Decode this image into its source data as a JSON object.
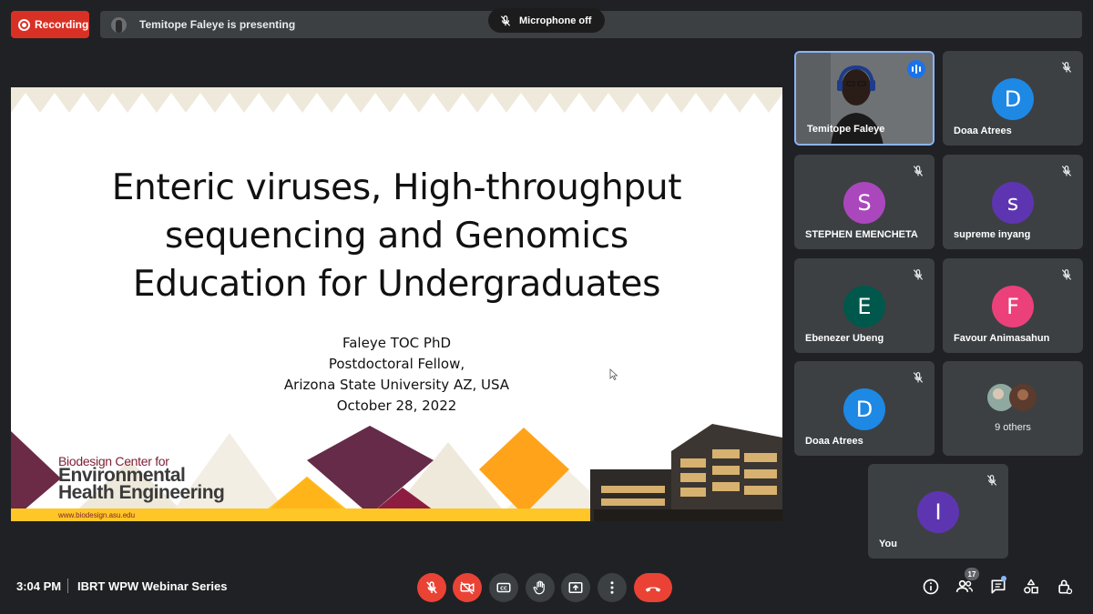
{
  "top": {
    "recording_label": "Recording",
    "presenting_text": "Temitope Faleye is presenting",
    "mic_toast": "Microphone off"
  },
  "slide": {
    "title_lines": [
      "Enteric viruses, High-throughput",
      "sequencing and Genomics",
      "Education for Undergraduates"
    ],
    "author": "Faleye TOC PhD",
    "role": "Postdoctoral Fellow,",
    "institution": "Arizona State University AZ, USA",
    "date": "October 28, 2022",
    "org_line1": "Biodesign Center for",
    "org_line2": "Environmental",
    "org_line3": "Health Engineering",
    "org_url": "www.biodesign.asu.edu"
  },
  "participants": [
    {
      "name": "Temitope Faleye",
      "initial": "",
      "color": "",
      "speaking": true
    },
    {
      "name": "Doaa Atrees",
      "initial": "D",
      "color": "#1e88e5"
    },
    {
      "name": "STEPHEN EMENCHETA",
      "initial": "S",
      "color": "#ab47bc"
    },
    {
      "name": "supreme inyang",
      "initial": "s",
      "color": "#5e35b1"
    },
    {
      "name": "Ebenezer Ubeng",
      "initial": "E",
      "color": "#00574b"
    },
    {
      "name": "Favour Animasahun",
      "initial": "F",
      "color": "#ec407a"
    },
    {
      "name": "Doaa Atrees",
      "initial": "D",
      "color": "#1e88e5"
    },
    {
      "name": "You",
      "initial": "I",
      "color": "#5e35b1"
    }
  ],
  "others_label": "9 others",
  "bottom": {
    "time": "3:04 PM",
    "meeting_title": "IBRT WPW Webinar Series",
    "participant_count": "17"
  },
  "icons": [
    "recording-icon",
    "mic-off-icon",
    "camera-off-icon",
    "captions-icon",
    "raise-hand-icon",
    "present-icon",
    "more-options-icon",
    "end-call-icon",
    "info-icon",
    "people-icon",
    "chat-icon",
    "activities-icon",
    "host-controls-icon"
  ],
  "colors": {
    "accent": "#8ab4f8",
    "danger": "#ea4335",
    "background": "#202124",
    "surface": "#3c4043"
  }
}
